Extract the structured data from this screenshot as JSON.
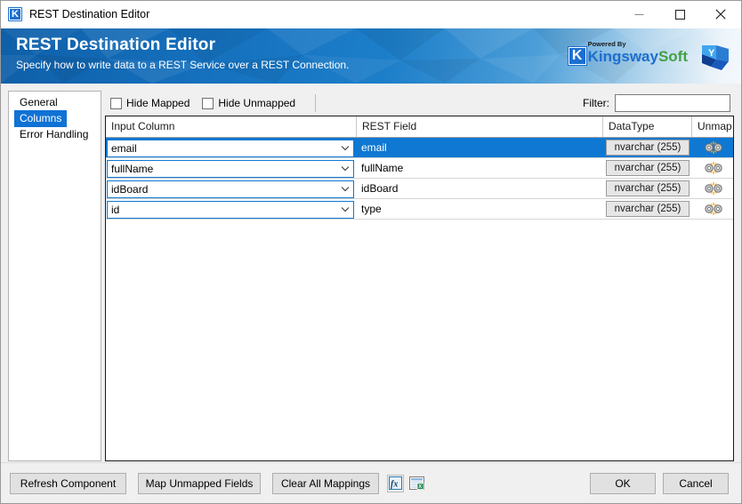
{
  "window": {
    "title": "REST Destination Editor",
    "app_icon": "kingswaysoft-k-icon",
    "minimize_label": "—",
    "maximize_label": "☐",
    "close_label": "✕"
  },
  "banner": {
    "title": "REST Destination Editor",
    "subtitle": "Specify how to write data to a REST Service over a REST Connection.",
    "brand_powered": "Powered By",
    "brand_kingsway": "Kingsway",
    "brand_soft": "Soft",
    "brand_k": "K",
    "product_logo": "yoke-y-logo"
  },
  "sidebar": {
    "items": [
      {
        "label": "General",
        "selected": false
      },
      {
        "label": "Columns",
        "selected": true
      },
      {
        "label": "Error Handling",
        "selected": false
      }
    ]
  },
  "toolbar": {
    "hide_mapped_label": "Hide Mapped",
    "hide_mapped_checked": false,
    "hide_unmapped_label": "Hide Unmapped",
    "hide_unmapped_checked": false,
    "filter_label": "Filter:",
    "filter_value": "",
    "filter_placeholder": ""
  },
  "grid": {
    "columns": [
      {
        "key": "input_column",
        "label": "Input Column"
      },
      {
        "key": "rest_field",
        "label": "REST Field"
      },
      {
        "key": "data_type",
        "label": "DataType"
      },
      {
        "key": "unmap",
        "label": "Unmap"
      }
    ],
    "rows": [
      {
        "input_column": "email",
        "rest_field": "email",
        "data_type": "nvarchar (255)",
        "unmap_icon": "unmap-icon",
        "selected": true
      },
      {
        "input_column": "fullName",
        "rest_field": "fullName",
        "data_type": "nvarchar (255)",
        "unmap_icon": "unmap-icon",
        "selected": false
      },
      {
        "input_column": "idBoard",
        "rest_field": "idBoard",
        "data_type": "nvarchar (255)",
        "unmap_icon": "unmap-icon",
        "selected": false
      },
      {
        "input_column": "id",
        "rest_field": "type",
        "data_type": "nvarchar (255)",
        "unmap_icon": "unmap-icon",
        "selected": false
      }
    ]
  },
  "footer": {
    "refresh_label": "Refresh Component",
    "map_unmapped_label": "Map Unmapped Fields",
    "clear_all_label": "Clear All Mappings",
    "expression_icon": "fx-expression-icon",
    "export_icon": "export-grid-icon",
    "ok_label": "OK",
    "cancel_label": "Cancel"
  },
  "colors": {
    "accent": "#0f78d2",
    "banner_dark": "#0f5fa8",
    "brand_blue": "#1c6fd0",
    "brand_green": "#43a047"
  }
}
